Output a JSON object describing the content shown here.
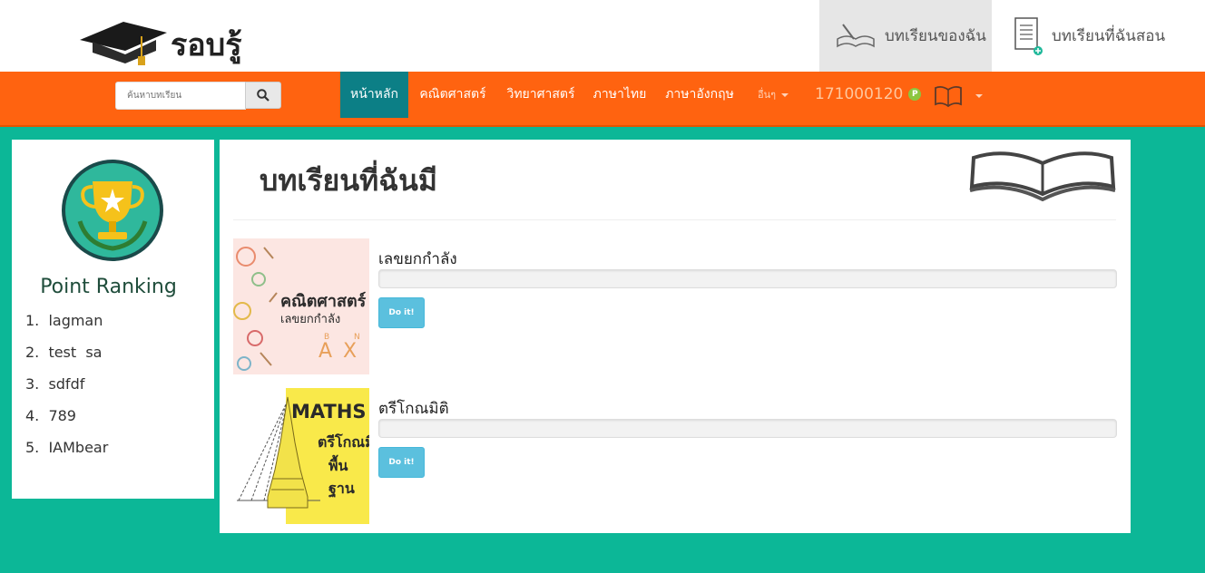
{
  "brand": {
    "logo_text": "รอบรู้"
  },
  "header": {
    "my_lessons": "บทเรียนของฉัน",
    "lessons_i_teach": "บทเรียนที่ฉันสอน"
  },
  "search": {
    "placeholder": "ค้นหาบทเรียน"
  },
  "nav": {
    "items": [
      {
        "label": "หน้าหลัก"
      },
      {
        "label": "คณิตศาสตร์"
      },
      {
        "label": "วิทยาศาสตร์"
      },
      {
        "label": "ภาษาไทย"
      },
      {
        "label": "ภาษาอังกฤษ"
      },
      {
        "label": "อื่นๆ"
      }
    ],
    "points": "171000120",
    "point_badge": "P"
  },
  "ranking": {
    "title": "Point Ranking",
    "items": [
      {
        "rank": "1.",
        "name": "lagman"
      },
      {
        "rank": "2.",
        "name": "test  sa"
      },
      {
        "rank": "3.",
        "name": "sdfdf"
      },
      {
        "rank": "4.",
        "name": "789"
      },
      {
        "rank": "5.",
        "name": "IAMbear"
      }
    ]
  },
  "main": {
    "title": "บทเรียนที่ฉันมี",
    "lessons": [
      {
        "title": "เลขยกกำลัง",
        "progress": 0,
        "button": "Do it!",
        "thumb_title": "คณิตศาสตร์",
        "thumb_sub": "เลขยกกำลัง",
        "thumb_formula": "A",
        "thumb_formula_b": "B",
        "thumb_formula_n": "N",
        "thumb_formula_x": "X"
      },
      {
        "title": "ตรีโกณมิติ",
        "progress": 0,
        "button": "Do it!",
        "thumb_title": "MATHS",
        "thumb_sub": "ตรีโกณมิติ",
        "thumb_sub2": "พื้นฐาน"
      }
    ]
  },
  "colors": {
    "teal_bg": "#0cb797",
    "nav_orange": "#ff6310",
    "nav_active": "#0c7f86",
    "button_info": "#5bc0de"
  }
}
